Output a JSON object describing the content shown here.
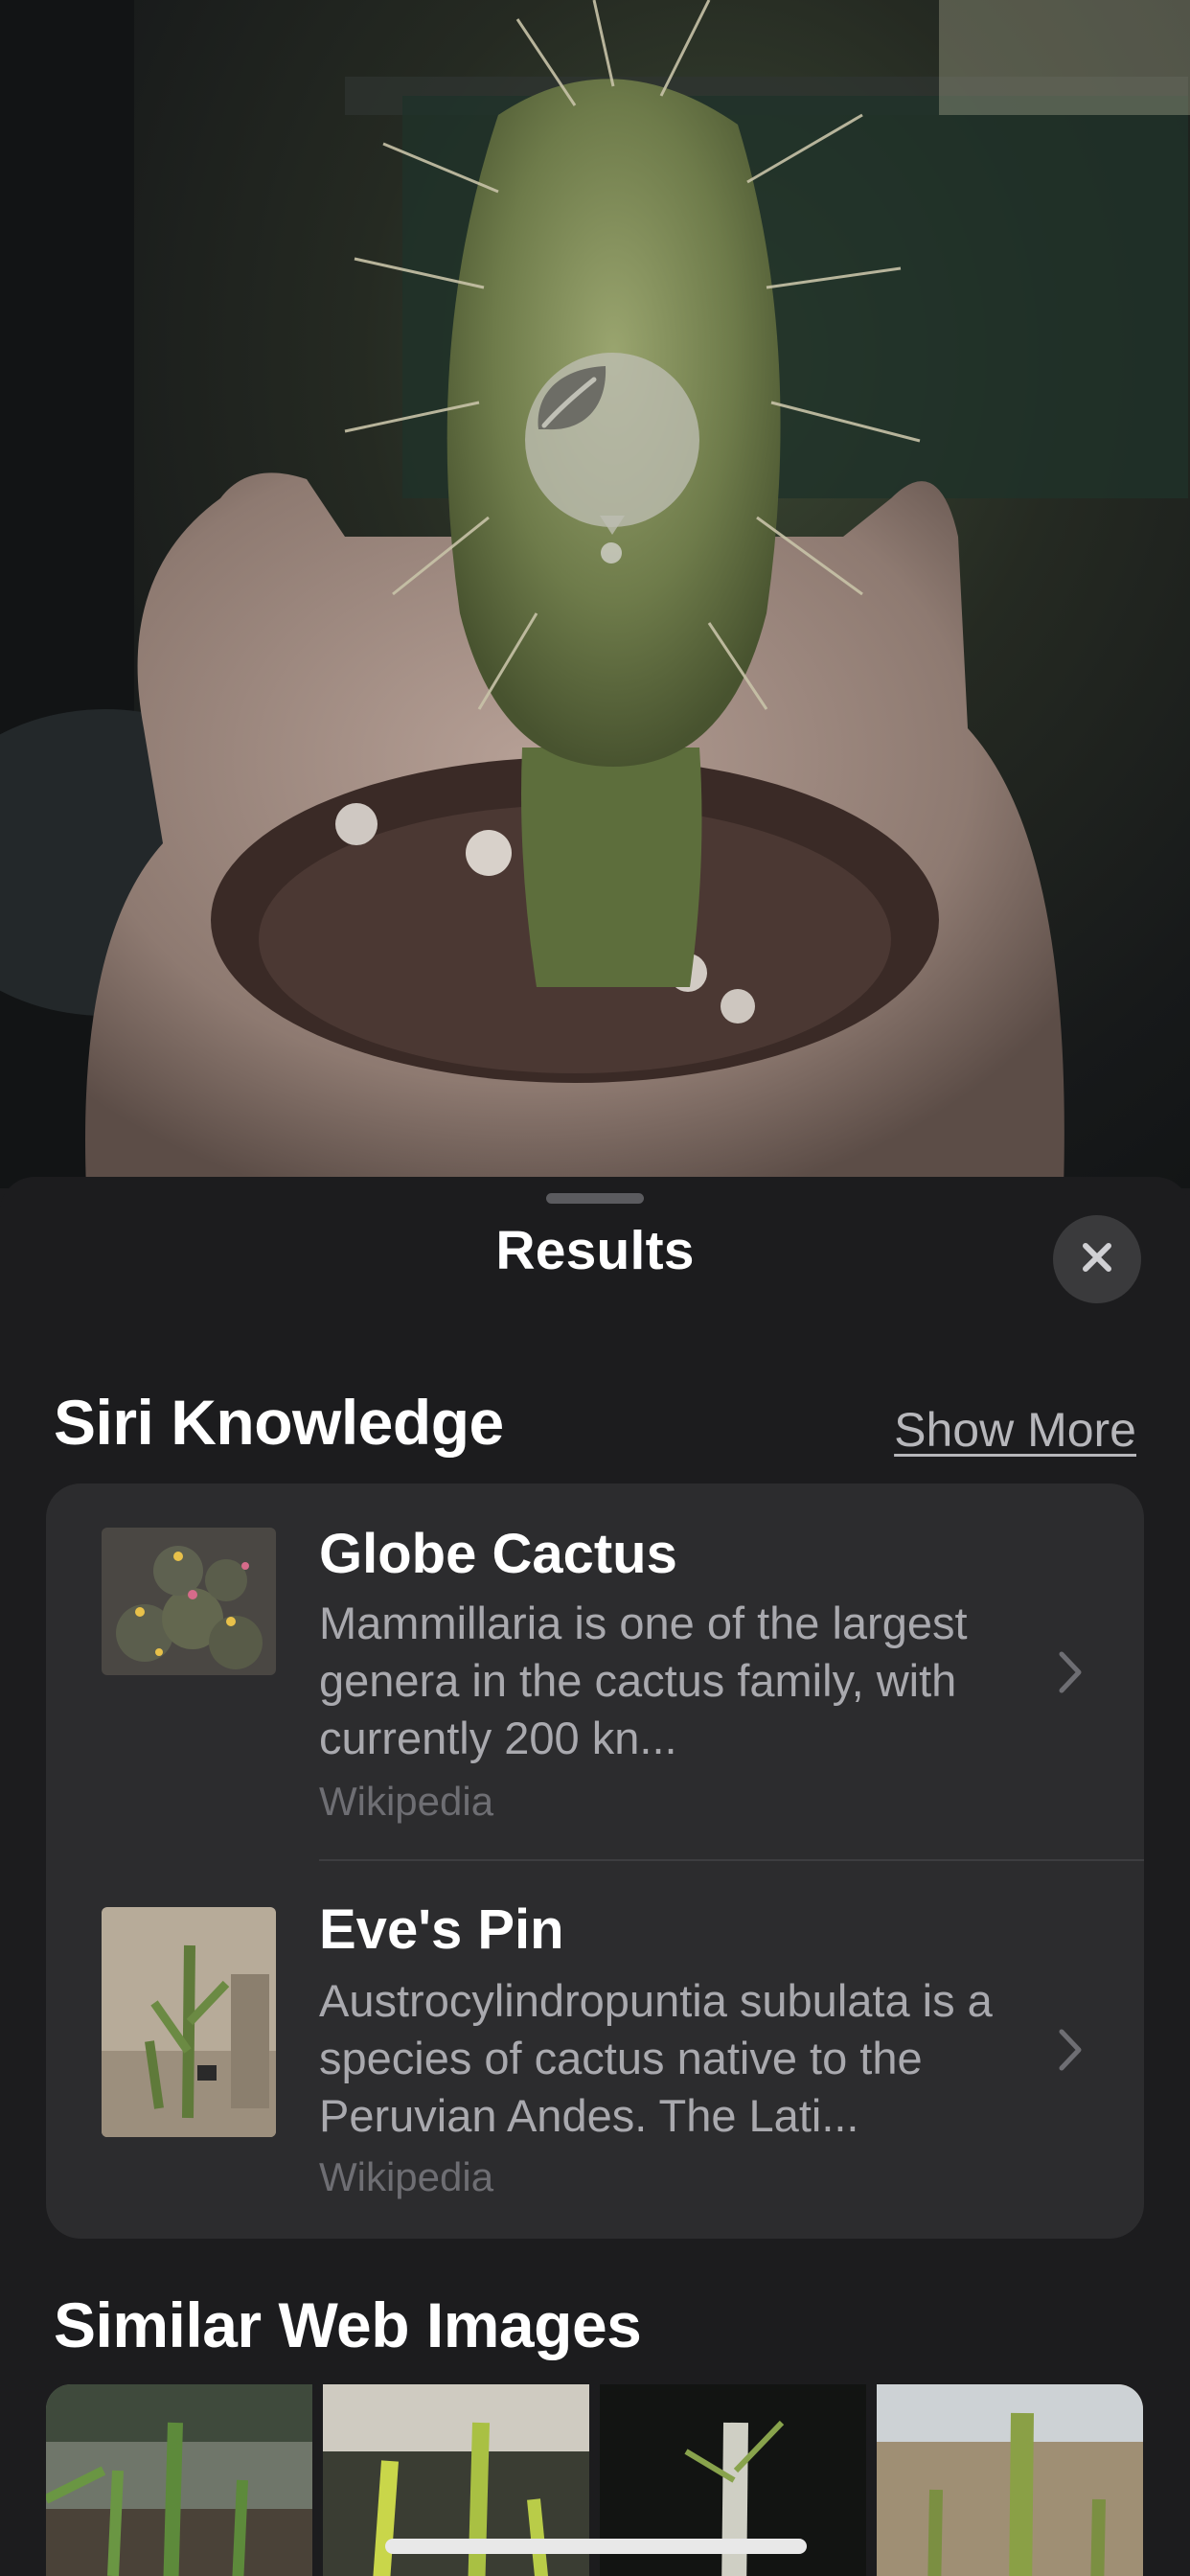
{
  "sheet": {
    "title": "Results",
    "close_icon": "close-icon"
  },
  "siri_knowledge": {
    "heading": "Siri Knowledge",
    "show_more": "Show More",
    "results": [
      {
        "title": "Globe Cactus",
        "description": "Mammillaria is one of the largest genera in the cactus family, with currently 200 kn...",
        "source": "Wikipedia"
      },
      {
        "title": "Eve's Pin",
        "description": "Austrocylindropuntia subulata is a species of cactus native to the Peruvian Andes. The Lati...",
        "source": "Wikipedia"
      }
    ]
  },
  "similar_web_images": {
    "heading": "Similar Web Images"
  },
  "photo": {
    "lookup_icon": "leaf-icon"
  }
}
